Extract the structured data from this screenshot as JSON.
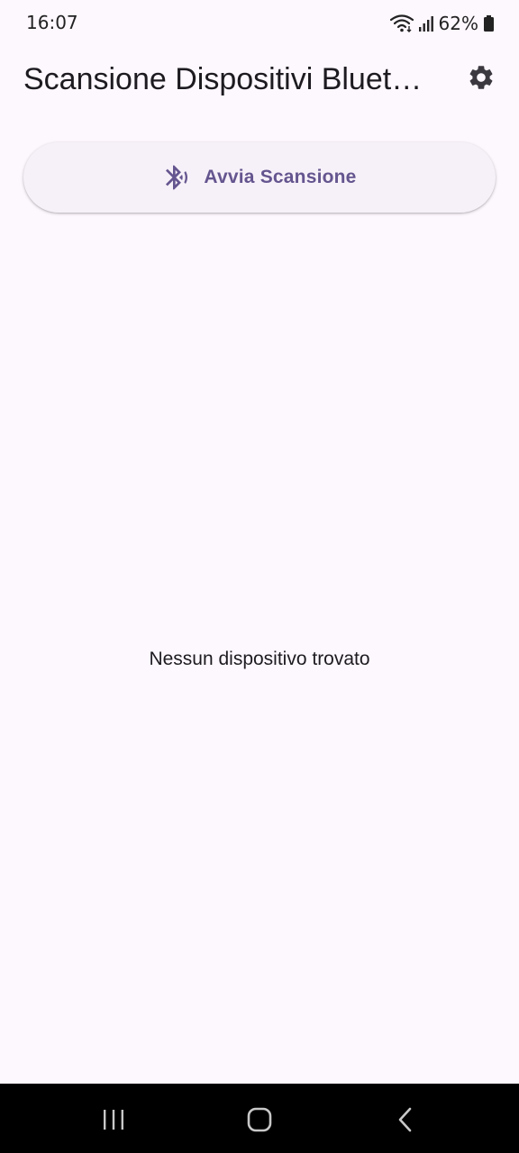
{
  "status_bar": {
    "time": "16:07",
    "battery_percent": "62%",
    "icons": [
      "wifi-icon",
      "signal-icon",
      "battery-icon"
    ]
  },
  "app_bar": {
    "title": "Scansione Dispositivi Bluetooth",
    "settings_icon": "gear-icon"
  },
  "scan_button": {
    "label": "Avvia Scansione",
    "icon": "bluetooth-searching-icon"
  },
  "empty_state": {
    "message": "Nessun dispositivo trovato"
  },
  "nav_bar": {
    "buttons": [
      "recent-apps-icon",
      "home-icon",
      "back-icon"
    ]
  },
  "colors": {
    "background": "#fdf7fe",
    "accent": "#65558f",
    "text": "#1d1b20",
    "button_surface": "#f6f1f8",
    "nav_background": "#000000"
  }
}
